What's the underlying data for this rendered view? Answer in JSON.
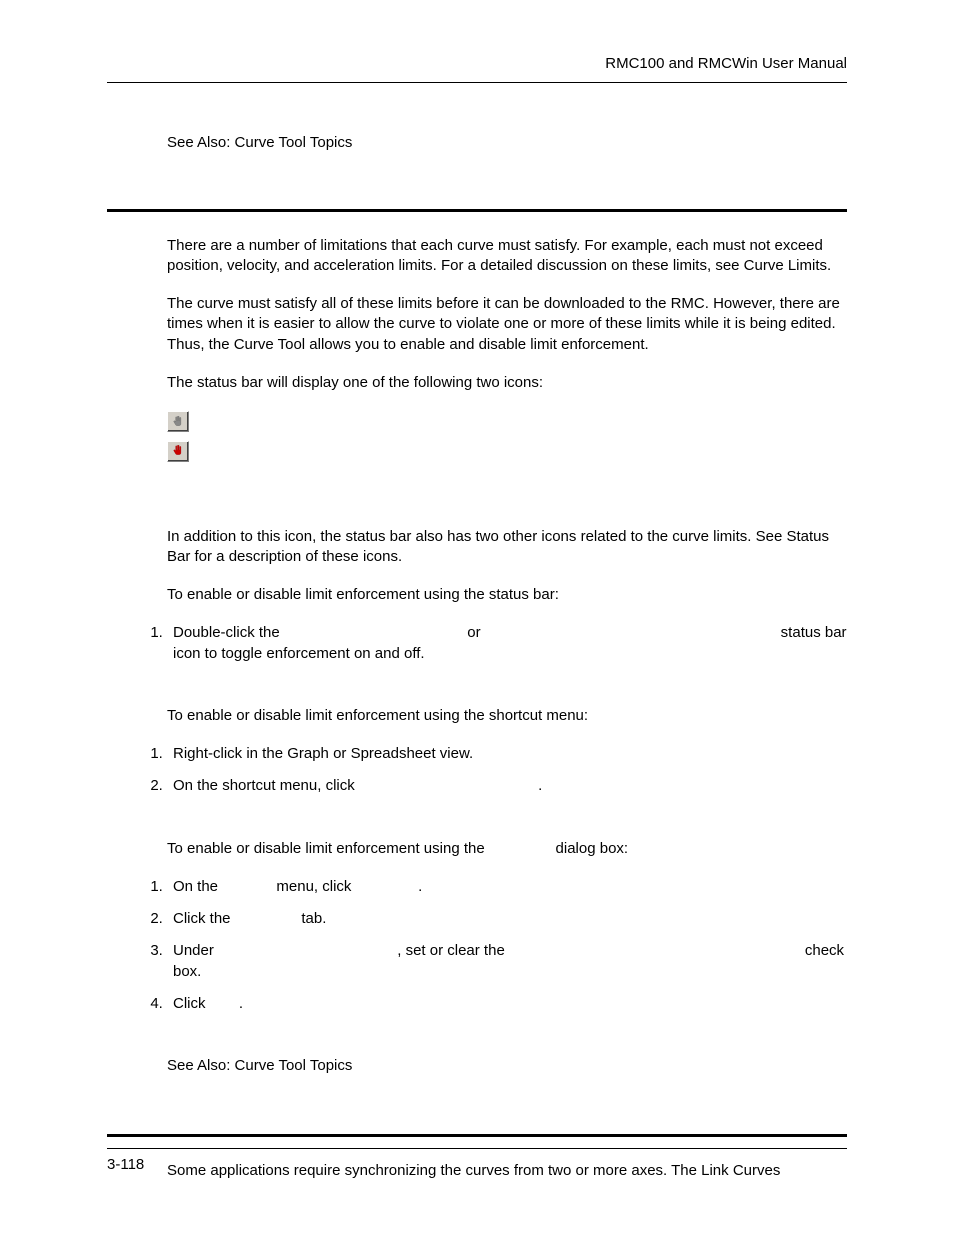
{
  "header": {
    "doc_title": "RMC100 and RMCWin User Manual"
  },
  "see_also_top": "See Also: Curve Tool Topics",
  "paras": {
    "p1": "There are a number of limitations that each curve must satisfy. For example, each must not exceed position, velocity, and acceleration limits. For a detailed discussion on these limits, see Curve Limits.",
    "p2": "The curve must satisfy all of these limits before it can be downloaded to the RMC. However, there are times when it is easier to allow the curve to violate one or more of these limits while it is being edited. Thus, the Curve Tool allows you to enable and disable limit enforcement.",
    "p3": "The status bar will display one of the following two icons:",
    "p4": "In addition to this icon, the status bar also has two other icons related to the curve limits. See Status Bar for a description of these icons.",
    "p5": "To enable or disable limit enforcement using the status bar:",
    "p6": "To enable or disable limit enforcement using the shortcut menu:",
    "p7_a": "To enable or disable limit enforcement using the ",
    "p7_b": " dialog box:"
  },
  "list1": {
    "i1_a": "Double-click the ",
    "i1_b": " or ",
    "i1_c": " status bar icon to toggle enforcement on and off."
  },
  "list2": {
    "i1": "Right-click in the Graph or Spreadsheet view.",
    "i2_a": "On the shortcut menu, click ",
    "i2_b": "."
  },
  "list3": {
    "i1_a": "On the ",
    "i1_b": " menu, click ",
    "i1_c": ".",
    "i2_a": "Click the ",
    "i2_b": " tab.",
    "i3_a": "Under ",
    "i3_b": ", set or clear the ",
    "i3_c": " check box.",
    "i4_a": "Click ",
    "i4_b": "."
  },
  "see_also_bottom": "See Also: Curve Tool Topics",
  "section2_p1": "Some applications require synchronizing the curves from two or more axes. The Link Curves",
  "footer": {
    "page_num": "3-118"
  },
  "spacer_medium": "                                           ",
  "spacer_large": "                                                                      ",
  "spacer_small": "               ",
  "spacer_tiny": "            ",
  "spacer_xs": "       "
}
